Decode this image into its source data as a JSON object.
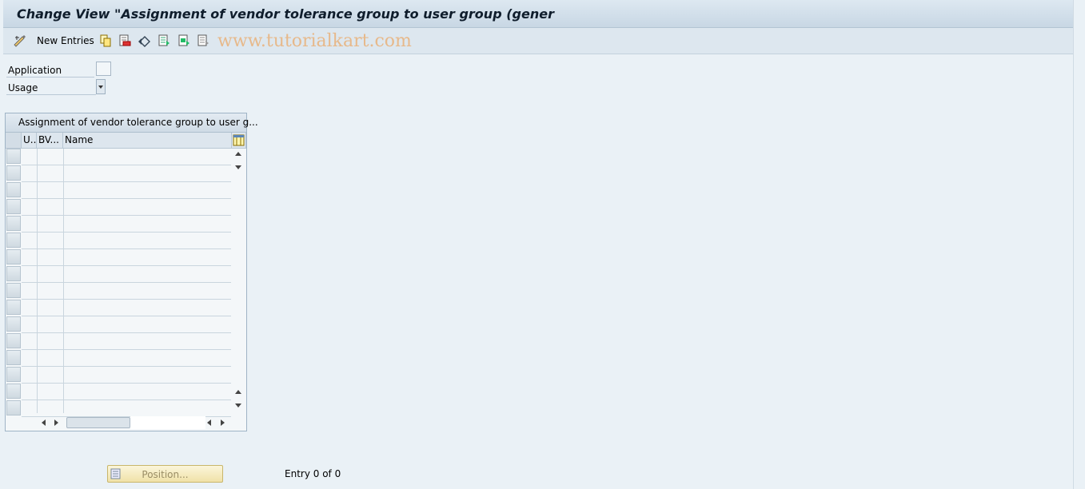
{
  "title": "Change View \"Assignment of vendor tolerance group to user group (gener",
  "toolbar": {
    "new_entries_label": "New Entries",
    "icons": [
      "display-change-icon",
      "copy-icon",
      "delete-icon",
      "undo-icon",
      "select-all-icon",
      "select-block-icon",
      "deselect-all-icon"
    ],
    "watermark": "www.tutorialkart.com"
  },
  "fields": {
    "application_label": "Application",
    "usage_label": "Usage"
  },
  "table": {
    "caption": "Assignment of vendor tolerance group to user g...",
    "columns": [
      "U..",
      "BV...",
      "Name"
    ],
    "rows": []
  },
  "footer": {
    "position_label": "Position...",
    "entry_text": "Entry 0 of 0"
  },
  "colors": {
    "title_bar": "#c8d7e4",
    "background": "#eaf1f6",
    "watermark": "#e7b98b",
    "position_button": "#f0e2a8"
  }
}
